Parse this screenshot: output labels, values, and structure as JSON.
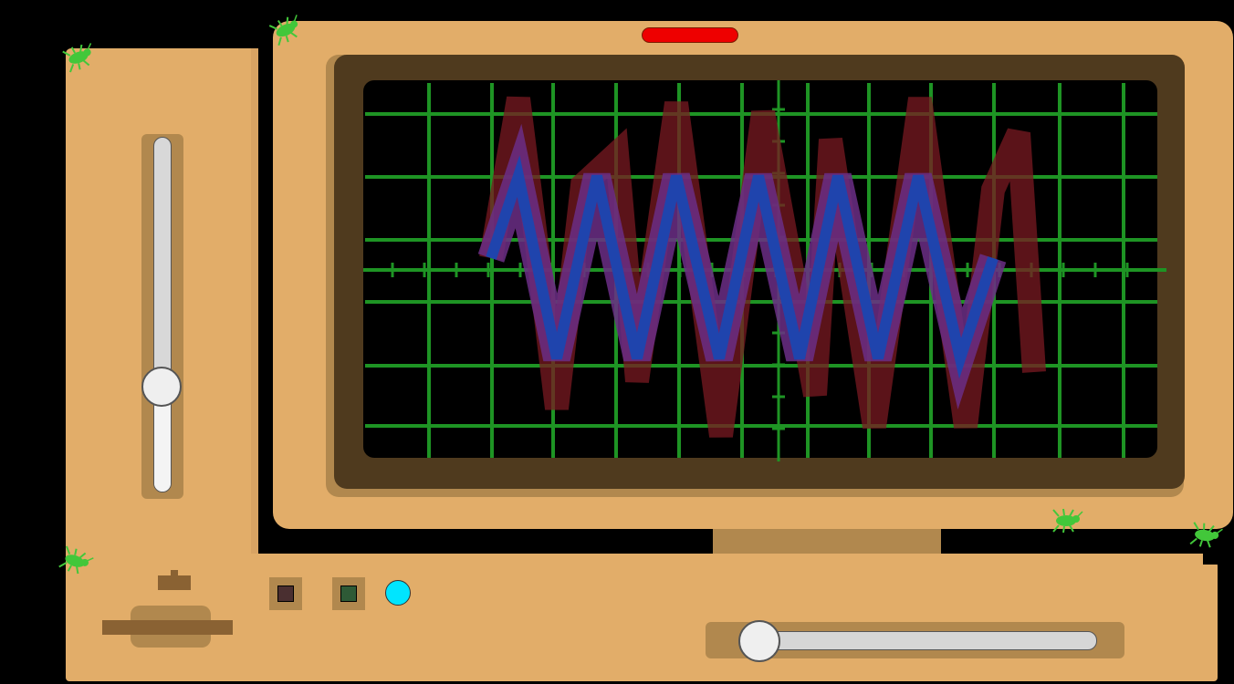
{
  "colors": {
    "case": "#e2ad69",
    "case_shadow": "#b1884e",
    "bezel": "#4f3a1e",
    "screen": "#000000",
    "grid": "#1e9424",
    "wave_primary": "#1f44ad",
    "wave_glow": "#6b2e86",
    "wave_ghost": "#7a1a22",
    "power_led": "#ee0000",
    "button_a": "#4a2f30",
    "button_b": "#2e5a36",
    "button_c": "#00e5ff",
    "bug": "#42c73a"
  },
  "oscilloscope": {
    "grid_columns": 12,
    "grid_rows": 6,
    "power_led_on": true
  },
  "controls": {
    "vertical_slider": {
      "value": 0.3
    },
    "horizontal_slider": {
      "value": 0.0
    },
    "buttons": [
      {
        "name": "button-a",
        "shape": "square"
      },
      {
        "name": "button-b",
        "shape": "square"
      },
      {
        "name": "button-c",
        "shape": "circle"
      }
    ],
    "dial": {
      "icon": "dial-knob-icon"
    }
  },
  "bugs": {
    "icon": "bug-icon",
    "count": 5
  }
}
